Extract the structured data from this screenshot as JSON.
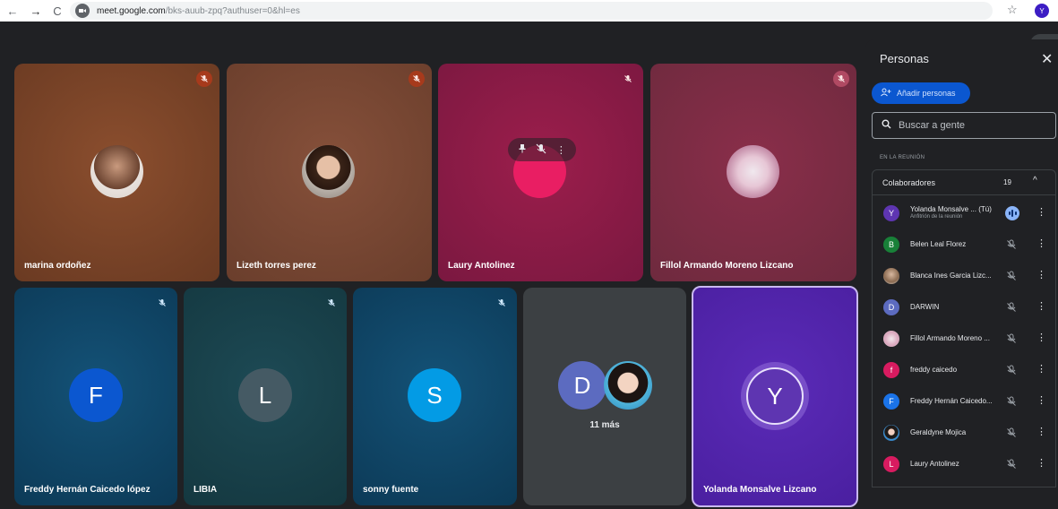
{
  "browser": {
    "url_domain": "meet.google.com",
    "url_path": "/bks-auub-zpq?authuser=0&hl=es",
    "profile_initial": "Y"
  },
  "meet": {
    "people_count": "19"
  },
  "tiles": [
    {
      "name": "marina ordoñez"
    },
    {
      "name": "Lizeth torres perez"
    },
    {
      "name": "Laury Antolinez"
    },
    {
      "name": "Fillol Armando Moreno Lizcano"
    },
    {
      "name": "Freddy Hernán Caicedo lópez",
      "initial": "F"
    },
    {
      "name": "LIBIA",
      "initial": "L"
    },
    {
      "name": "sonny fuente",
      "initial": "S"
    },
    {
      "name": "",
      "initial": "D",
      "more": "11 más"
    },
    {
      "name": "Yolanda Monsalve Lizcano",
      "initial": "Y"
    }
  ],
  "sidebar": {
    "title": "Personas",
    "add_label": "Añadir personas",
    "search_placeholder": "Buscar a gente",
    "section_label": "EN LA REUNIÓN",
    "group_title": "Colaboradores",
    "group_count": "19",
    "people": [
      {
        "initial": "Y",
        "name": "Yolanda Monsalve ...  (Tú)",
        "sub": "Anfitrión de la reunión",
        "color": "#5e35b1"
      },
      {
        "initial": "B",
        "name": "Belen Leal Florez",
        "color": "#188038"
      },
      {
        "initial": "",
        "name": "Blanca Ines Garcia Lizc...",
        "color": "#a07850"
      },
      {
        "initial": "D",
        "name": "DARWIN",
        "color": "#5c6bc0"
      },
      {
        "initial": "",
        "name": "Fillol Armando Moreno ...",
        "color": "#e8e0e0"
      },
      {
        "initial": "f",
        "name": "freddy caicedo",
        "color": "#d81b60"
      },
      {
        "initial": "F",
        "name": "Freddy Hernán Caicedo...",
        "color": "#1a73e8"
      },
      {
        "initial": "",
        "name": "Geraldyne Mojica",
        "color": "#355"
      },
      {
        "initial": "L",
        "name": "Laury Antolinez",
        "color": "#d81b60"
      }
    ]
  }
}
